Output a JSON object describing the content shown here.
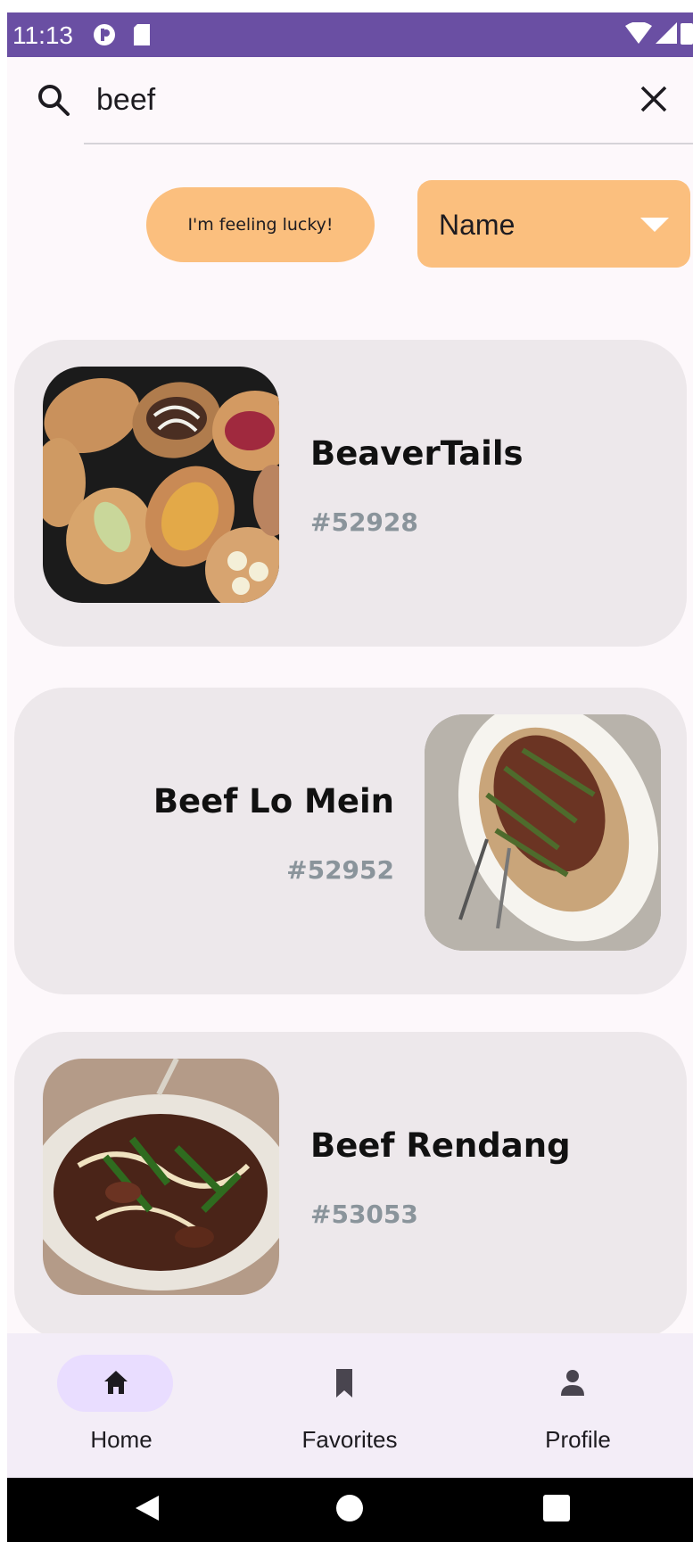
{
  "status_bar": {
    "time": "11:13"
  },
  "search": {
    "query": "beef",
    "placeholder": ""
  },
  "filters": {
    "lucky_label": "I'm feeling lucky!",
    "sort_value": "Name"
  },
  "recipes": [
    {
      "name": "BeaverTails",
      "id": "#52928"
    },
    {
      "name": "Beef Lo Mein",
      "id": "#52952"
    },
    {
      "name": "Beef Rendang",
      "id": "#53053"
    }
  ],
  "bottom_nav": {
    "items": [
      {
        "label": "Home",
        "icon": "home-icon",
        "active": true
      },
      {
        "label": "Favorites",
        "icon": "bookmark-icon",
        "active": false
      },
      {
        "label": "Profile",
        "icon": "person-icon",
        "active": false
      }
    ]
  },
  "colors": {
    "status_bar": "#6a4fa3",
    "accent_orange": "#fbbf7e",
    "card_background": "#ede8eb",
    "id_text": "#8a949b"
  }
}
